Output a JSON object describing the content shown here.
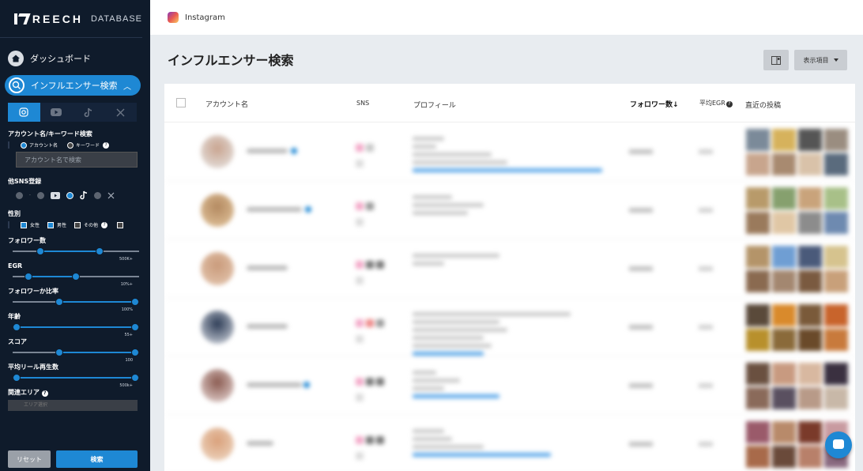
{
  "brand": {
    "name": "REECH",
    "sub": "DATABASE"
  },
  "nav": {
    "dashboard": "ダッシュボード",
    "influencer_search": "インフルエンサー検索"
  },
  "sns_tabs": [
    "instagram",
    "youtube",
    "tiktok",
    "x"
  ],
  "filters": {
    "account_keyword_label": "アカウント名/キーワード検索",
    "radio_account": "アカウント名",
    "radio_keyword": "キーワード",
    "search_placeholder": "アカウント名で検索",
    "other_sns_label": "他SNS登録",
    "gender_label": "性別",
    "gender_female": "女性",
    "gender_male": "男性",
    "gender_other": "その他",
    "followers_label": "フォロワー数",
    "followers_max": "500K+",
    "egr_label": "EGR",
    "egr_max": "10%+",
    "follower_ratio_label": "フォロワーか比率",
    "follower_ratio_max": "100%",
    "age_label": "年齢",
    "age_max": "55+",
    "score_label": "スコア",
    "score_max": "100",
    "reel_label": "平均リール再生数",
    "reel_max": "500k+",
    "area_label": "関連エリア",
    "area_placeholder": "エリア選択"
  },
  "sliders": {
    "followers": [
      0.2,
      0.7
    ],
    "egr": [
      0.1,
      0.5
    ],
    "follower_ratio": [
      0.36,
      1.0
    ],
    "age": [
      0.0,
      1.0
    ],
    "score": [
      0.36,
      1.0
    ],
    "reel": [
      0.0,
      1.0
    ]
  },
  "buttons": {
    "reset": "リセット",
    "search": "検索"
  },
  "header": {
    "platform": "Instagram",
    "title": "インフルエンサー検索",
    "display_items": "表示項目"
  },
  "table": {
    "columns": {
      "account": "アカウント名",
      "sns": "SNS",
      "profile": "プロフィール",
      "followers": "フォロワー数",
      "egr": "平均EGR",
      "posts": "直近の投稿"
    }
  },
  "colors": {
    "sidebar": "#0f1b2b",
    "accent": "#1e88d4",
    "bg": "#e8ecf0"
  }
}
